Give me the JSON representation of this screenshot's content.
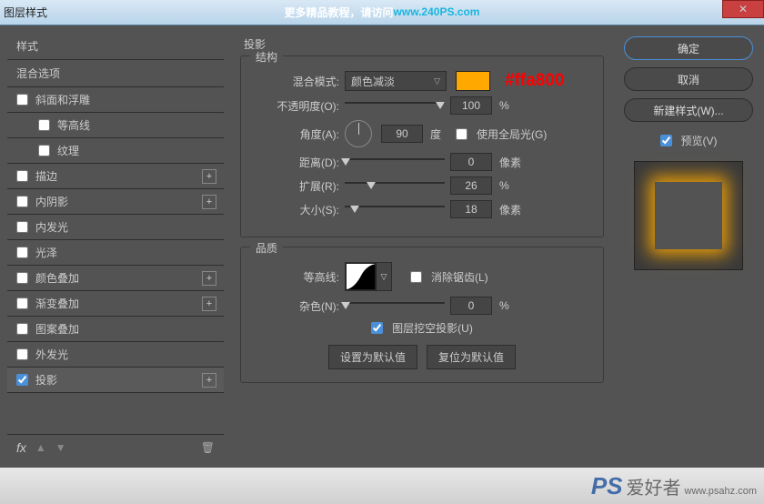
{
  "window": {
    "title": "图层样式"
  },
  "banner": {
    "t1": "更多精品教程，请访问 ",
    "t2": "www.240PS.com"
  },
  "left": {
    "header": "样式",
    "blend_options": "混合选项",
    "items": [
      {
        "label": "斜面和浮雕",
        "checked": false,
        "plus": false,
        "sub": false
      },
      {
        "label": "等高线",
        "checked": false,
        "plus": false,
        "sub": true
      },
      {
        "label": "纹理",
        "checked": false,
        "plus": false,
        "sub": true
      },
      {
        "label": "描边",
        "checked": false,
        "plus": true,
        "sub": false
      },
      {
        "label": "内阴影",
        "checked": false,
        "plus": true,
        "sub": false
      },
      {
        "label": "内发光",
        "checked": false,
        "plus": false,
        "sub": false
      },
      {
        "label": "光泽",
        "checked": false,
        "plus": false,
        "sub": false
      },
      {
        "label": "颜色叠加",
        "checked": false,
        "plus": true,
        "sub": false
      },
      {
        "label": "渐变叠加",
        "checked": false,
        "plus": true,
        "sub": false
      },
      {
        "label": "图案叠加",
        "checked": false,
        "plus": false,
        "sub": false
      },
      {
        "label": "外发光",
        "checked": false,
        "plus": false,
        "sub": false
      },
      {
        "label": "投影",
        "checked": true,
        "plus": true,
        "sub": false,
        "active": true
      }
    ],
    "fx": "fx"
  },
  "center": {
    "title": "投影",
    "structure": {
      "legend": "结构",
      "blend_mode_label": "混合模式:",
      "blend_mode_value": "颜色减淡",
      "swatch_hex": "#ffa800",
      "opacity_label": "不透明度(O):",
      "opacity_value": "100",
      "opacity_unit": "%",
      "angle_label": "角度(A):",
      "angle_value": "90",
      "angle_unit": "度",
      "global_light_label": "使用全局光(G)",
      "distance_label": "距离(D):",
      "distance_value": "0",
      "distance_unit": "像素",
      "spread_label": "扩展(R):",
      "spread_value": "26",
      "spread_unit": "%",
      "size_label": "大小(S):",
      "size_value": "18",
      "size_unit": "像素"
    },
    "quality": {
      "legend": "品质",
      "contour_label": "等高线:",
      "antialias_label": "消除锯齿(L)",
      "noise_label": "杂色(N):",
      "noise_value": "0",
      "noise_unit": "%"
    },
    "knockout_label": "图层挖空投影(U)",
    "reset_default": "设置为默认值",
    "restore_default": "复位为默认值"
  },
  "right": {
    "ok": "确定",
    "cancel": "取消",
    "new_style": "新建样式(W)...",
    "preview": "预览(V)"
  },
  "watermark": {
    "ps": "PS",
    "cn": "爱好者",
    "url": "www.psahz.com"
  }
}
